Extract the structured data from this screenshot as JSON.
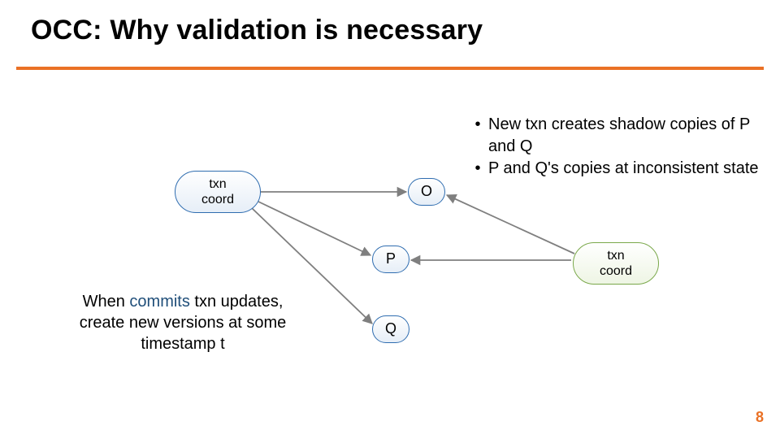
{
  "title": "OCC:  Why validation is necessary",
  "nodes": {
    "coord1": "txn\ncoord",
    "coord2": "txn\ncoord",
    "O": "O",
    "P": "P",
    "Q": "Q"
  },
  "bullets": [
    "New txn creates shadow copies of P and Q",
    "P and Q's copies at inconsistent state"
  ],
  "leftCaption": {
    "pre": "When ",
    "accent": "commits",
    "post": " txn updates, create new versions at some timestamp t"
  },
  "pageNumber": "8"
}
